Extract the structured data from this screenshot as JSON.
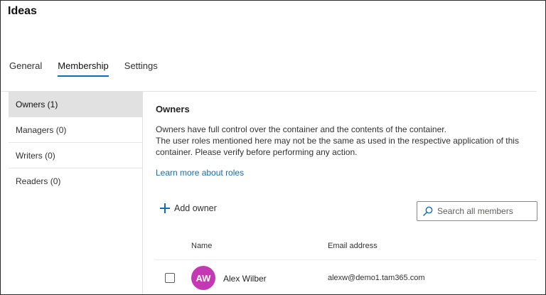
{
  "page": {
    "title": "Ideas"
  },
  "tabs": [
    {
      "label": "General",
      "active": false
    },
    {
      "label": "Membership",
      "active": true
    },
    {
      "label": "Settings",
      "active": false
    }
  ],
  "sidebar": {
    "items": [
      {
        "label": "Owners (1)",
        "active": true
      },
      {
        "label": "Managers (0)",
        "active": false
      },
      {
        "label": "Writers (0)",
        "active": false
      },
      {
        "label": "Readers (0)",
        "active": false
      }
    ]
  },
  "main": {
    "section_title": "Owners",
    "description_lines": [
      "Owners have full control over the container and the contents of the container.",
      "The user roles mentioned here may not be the same as used in the respective application of this",
      "container. Please verify before performing any action."
    ],
    "learn_more_link": "Learn more about roles",
    "add_button_label": "Add owner",
    "search": {
      "placeholder": "Search all members"
    },
    "table": {
      "headers": {
        "name": "Name",
        "email": "Email address"
      },
      "rows": [
        {
          "initials": "AW",
          "name": "Alex Wilber",
          "email": "alexw@demo1.tam365.com",
          "avatar_color": "#c239b3"
        }
      ]
    }
  },
  "colors": {
    "accent": "#0f6cbd",
    "active_nav_bg": "#e1e1e1"
  },
  "icons": {
    "add": "plus-icon",
    "search": "search-icon"
  }
}
